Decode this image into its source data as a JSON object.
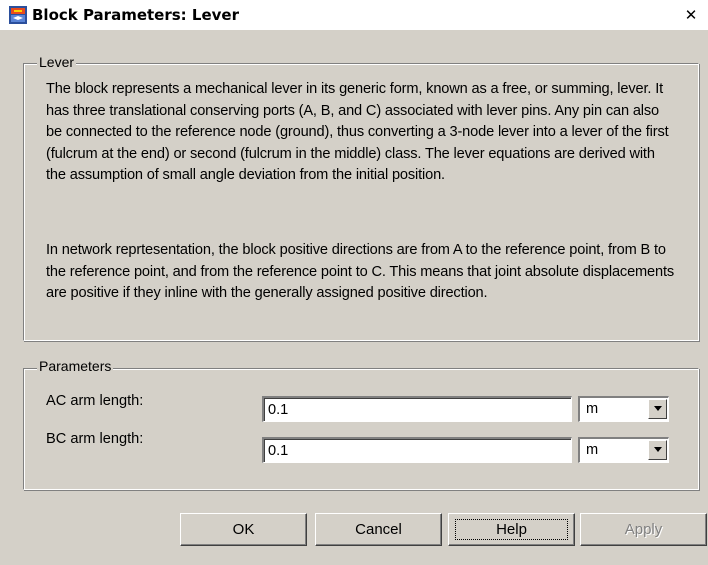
{
  "window": {
    "title": "Block Parameters: Lever",
    "close_symbol": "✕",
    "icon": "simulink-block-icon"
  },
  "lever_group": {
    "label": "Lever",
    "paragraph1": "The block represents a mechanical lever in its generic form, known as a free, or summing, lever. It has three translational conserving ports (A, B, and C) associated with lever pins. Any pin can also be connected to the reference node (ground), thus converting a 3-node lever into a lever of the first (fulcrum at the end) or second (fulcrum in the middle) class. The lever equations are derived with the assumption of small angle deviation from the initial position.",
    "paragraph2": "In network reprtesentation, the block positive directions are from A to the reference point, from B to the reference point, and from the reference point to C. This means that joint absolute displacements are positive if they inline with the generally assigned positive direction."
  },
  "parameters_group": {
    "label": "Parameters",
    "rows": [
      {
        "label": "AC arm length:",
        "value": "0.1",
        "unit": "m"
      },
      {
        "label": "BC arm length:",
        "value": "0.1",
        "unit": "m"
      }
    ]
  },
  "buttons": {
    "ok": "OK",
    "cancel": "Cancel",
    "help": "Help",
    "apply": "Apply"
  },
  "colors": {
    "dialog_bg": "#d4d0c8",
    "shadow": "#808080",
    "highlight": "#ffffff",
    "disabled_text": "#808080"
  }
}
